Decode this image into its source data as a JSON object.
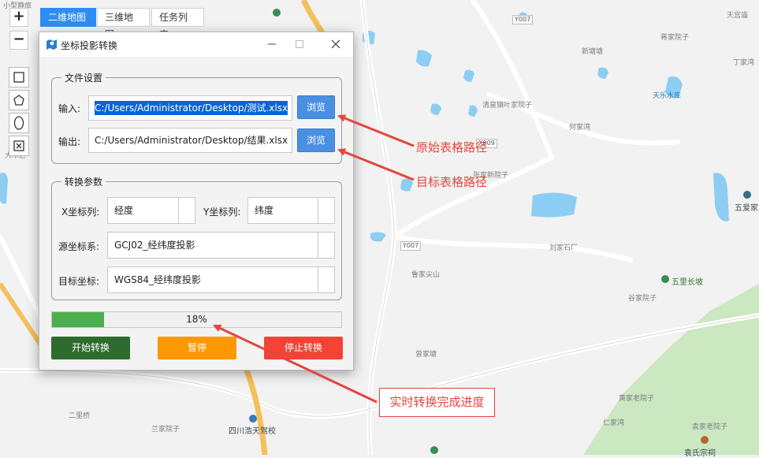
{
  "map": {
    "labels": [
      "小型静旅",
      "Y007",
      "天宫庙",
      "蒋家院子",
      "新塘塘",
      "丁家湾",
      "天乐水库",
      "清泉镇叶家院子",
      "何家湾",
      "X009",
      "张家新院子",
      "五爱家",
      "Y007",
      "刘家石厂",
      "鲁家尖山",
      "五里长坡",
      "谷家院子",
      "曾家塘",
      "黄家老院子",
      "仁家湾",
      "二里桥",
      "兰家院子",
      "四川浩天驾校",
      "袁家老院子",
      "袁氏宗祠",
      "大市区"
    ]
  },
  "tabs": [
    {
      "label": "二维地图",
      "active": true
    },
    {
      "label": "三维地图",
      "active": false
    },
    {
      "label": "任务列表",
      "active": false
    }
  ],
  "zoom": {
    "in": "+",
    "out": "−"
  },
  "dialog": {
    "title": "坐标投影转换",
    "file_settings": {
      "legend": "文件设置",
      "input_label": "输入:",
      "input_value": "C:/Users/Administrator/Desktop/测试.xlsx",
      "output_label": "输出:",
      "output_value": "C:/Users/Administrator/Desktop/结果.xlsx",
      "browse": "浏览"
    },
    "params": {
      "legend": "转换参数",
      "x_label": "X坐标列:",
      "x_value": "经度",
      "y_label": "Y坐标列:",
      "y_value": "纬度",
      "src_label": "源坐标系:",
      "src_value": "GCJ02_经纬度投影",
      "dst_label": "目标坐标:",
      "dst_value": "WGS84_经纬度投影"
    },
    "progress": {
      "value": 0.18,
      "text": "18%"
    },
    "buttons": {
      "start": "开始转换",
      "pause": "暂停",
      "stop": "停止转换"
    },
    "colors": {
      "start": "#2e6b2f",
      "pause": "#ff9800",
      "stop": "#f44336",
      "progress": "#4caf50",
      "browse": "#4a90e2"
    }
  },
  "annotations": {
    "source_path": "原始表格路径",
    "target_path": "目标表格路径",
    "progress_note": "实时转换完成进度"
  }
}
